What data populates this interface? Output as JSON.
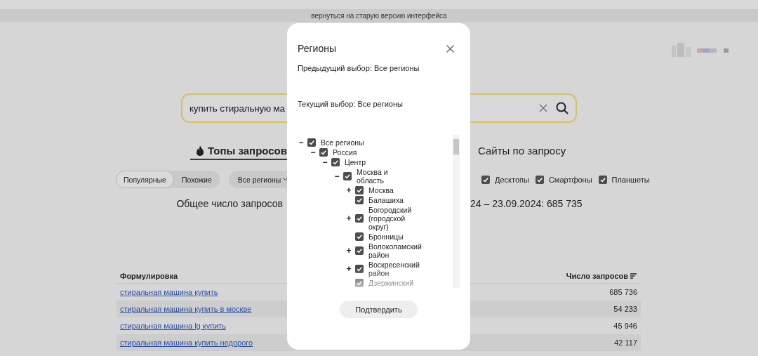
{
  "banner": {
    "text": "вернуться на старую версию интерфейса"
  },
  "search": {
    "value": "купить стиральную ма"
  },
  "tabs": [
    {
      "label": "Топы запросов",
      "selected": true
    },
    {
      "label": "Сайты по запросу",
      "selected": false
    }
  ],
  "modes": [
    {
      "label": "Популярные",
      "selected": true
    },
    {
      "label": "Похожие",
      "selected": false
    }
  ],
  "region_button": {
    "label": "Все регионы"
  },
  "devices": [
    {
      "label": "Десктопы",
      "checked": true
    },
    {
      "label": "Смартфоны",
      "checked": true
    },
    {
      "label": "Планшеты",
      "checked": true
    }
  ],
  "total": {
    "left": "Общее число запросов",
    "right": "24 – 23.09.2024: 685 735"
  },
  "table": {
    "columns": [
      "Формулировка",
      "Число запросов"
    ],
    "rows": [
      {
        "phrase": "стиральная машина купить",
        "count": "685 736"
      },
      {
        "phrase": "стиральная машина купить в москве",
        "count": "54 233"
      },
      {
        "phrase": "стиральная машина lg купить",
        "count": "45 946"
      },
      {
        "phrase": "стиральная машина купить недорого",
        "count": "42 117"
      }
    ]
  },
  "dialog": {
    "title": "Регионы",
    "previous": "Предыдущий выбор: Все регионы",
    "current": "Текущий выбор: Все регионы",
    "confirm": "Подтвердить",
    "tree": [
      {
        "label": "Все регионы",
        "checked": true,
        "toggle": "−",
        "children": [
          {
            "label": "Россия",
            "checked": true,
            "toggle": "−",
            "children": [
              {
                "label": "Центр",
                "checked": true,
                "toggle": "−",
                "children": [
                  {
                    "label": "Москва и область",
                    "checked": true,
                    "toggle": "−",
                    "children": [
                      {
                        "label": "Москва",
                        "checked": true,
                        "toggle": "+"
                      },
                      {
                        "label": "Балашиха",
                        "checked": true
                      },
                      {
                        "label": "Богородский (городской округ)",
                        "checked": true,
                        "toggle": "+"
                      },
                      {
                        "label": "Бронницы",
                        "checked": true
                      },
                      {
                        "label": "Волоколамский район",
                        "checked": true,
                        "toggle": "+"
                      },
                      {
                        "label": "Воскресенский район",
                        "checked": true,
                        "toggle": "+"
                      },
                      {
                        "label": "Дзержинский",
                        "checked": true
                      }
                    ]
                  }
                ]
              }
            ]
          }
        ]
      }
    ]
  }
}
